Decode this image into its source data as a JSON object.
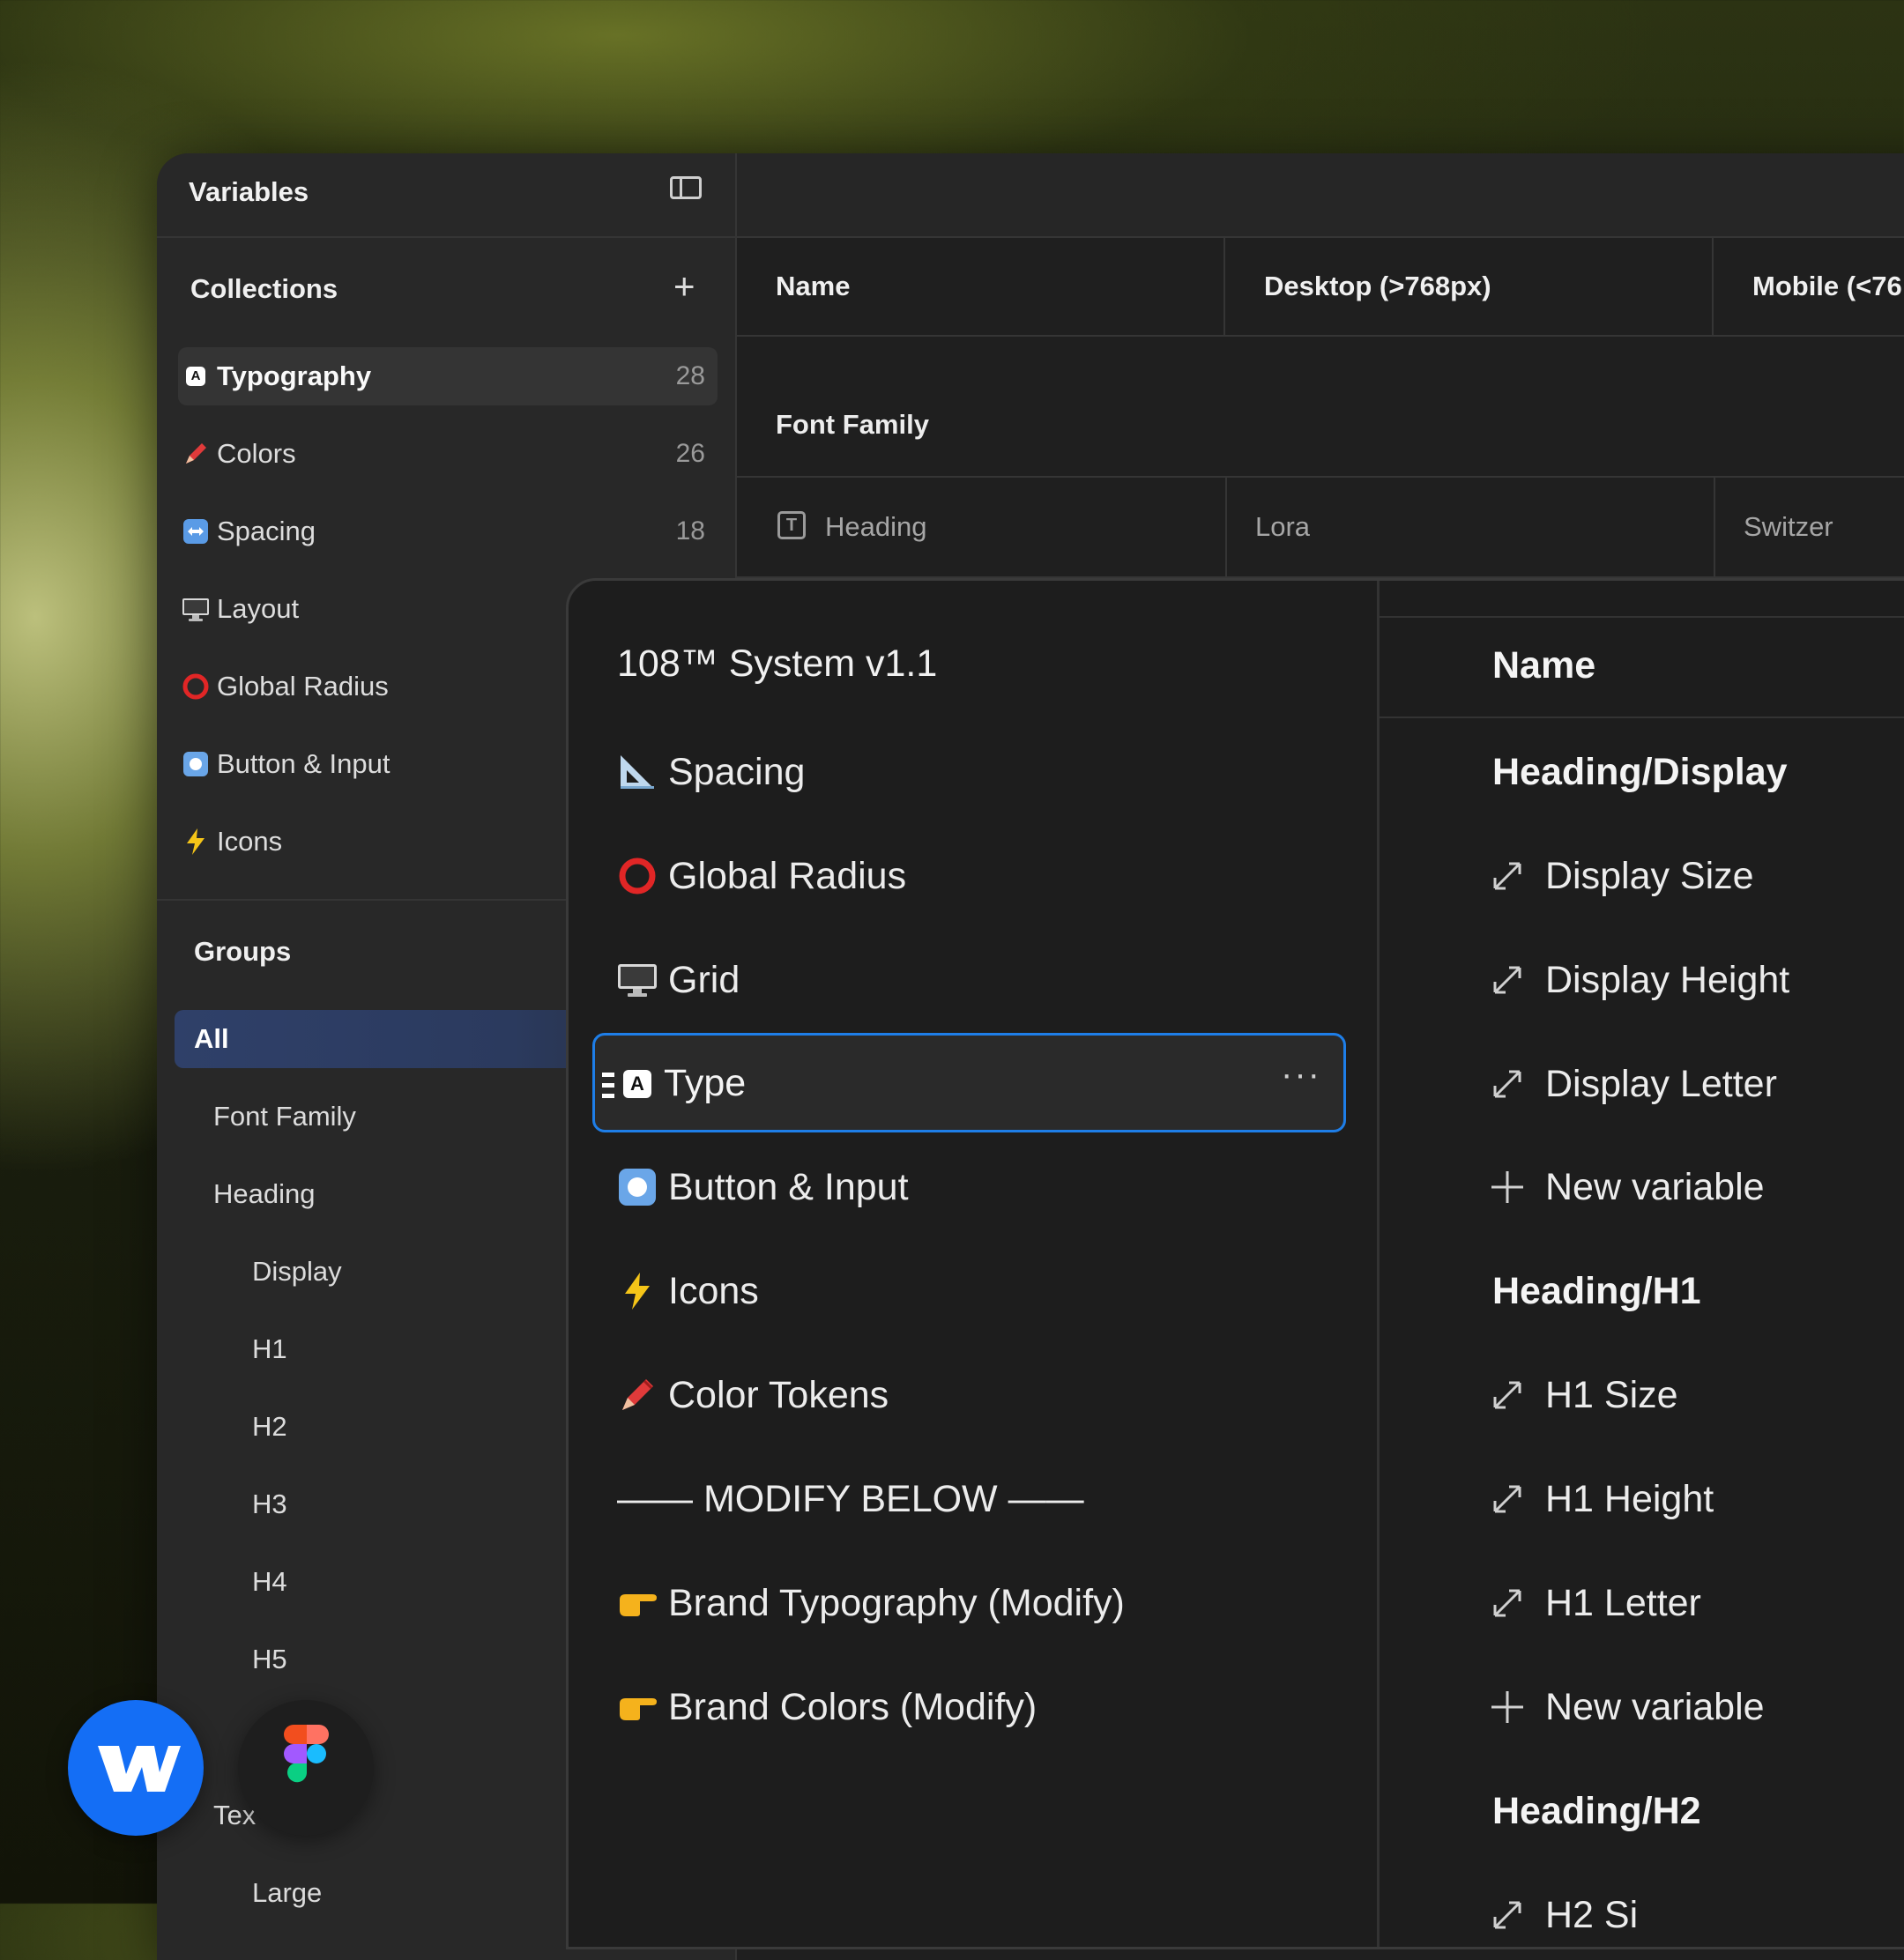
{
  "sidebar": {
    "title": "Variables",
    "collections_label": "Collections",
    "collections": [
      {
        "icon": "a-box-icon",
        "label": "Typography",
        "count": "28"
      },
      {
        "icon": "crayon-icon",
        "label": "Colors",
        "count": "26"
      },
      {
        "icon": "left-right-arrow-icon",
        "label": "Spacing",
        "count": "18"
      },
      {
        "icon": "desktop-computer-icon",
        "label": "Layout",
        "count": ""
      },
      {
        "icon": "red-circle-icon",
        "label": "Global Radius",
        "count": ""
      },
      {
        "icon": "record-button-icon",
        "label": "Button & Input",
        "count": ""
      },
      {
        "icon": "lightning-icon",
        "label": "Icons",
        "count": ""
      }
    ],
    "groups_label": "Groups",
    "groups": [
      {
        "label": "All",
        "level": 0,
        "active": true
      },
      {
        "label": "Font Family",
        "level": 1
      },
      {
        "label": "Heading",
        "level": 1
      },
      {
        "label": "Display",
        "level": 2
      },
      {
        "label": "H1",
        "level": 2
      },
      {
        "label": "H2",
        "level": 2
      },
      {
        "label": "H3",
        "level": 2
      },
      {
        "label": "H4",
        "level": 2
      },
      {
        "label": "H5",
        "level": 2
      },
      {
        "label": "Tex",
        "level": 1
      },
      {
        "label": "Large",
        "level": 2
      }
    ]
  },
  "table": {
    "columns": [
      "Name",
      "Desktop (>768px)",
      "Mobile (<76"
    ],
    "section": "Font Family",
    "row": {
      "name": "Heading",
      "desktop": "Lora",
      "mobile": "Switzer"
    }
  },
  "panel": {
    "title": "108™ System v1.1",
    "items": [
      {
        "icon": "triangular-ruler-icon",
        "label": "Spacing"
      },
      {
        "icon": "red-circle-icon",
        "label": "Global Radius"
      },
      {
        "icon": "desktop-computer-icon",
        "label": "Grid"
      },
      {
        "icon": "a-box-icon",
        "label": "Type",
        "selected": true
      },
      {
        "icon": "record-button-icon",
        "label": "Button & Input"
      },
      {
        "icon": "lightning-icon",
        "label": "Icons"
      },
      {
        "icon": "crayon-icon",
        "label": "Color Tokens"
      },
      {
        "icon": "",
        "label": "—— MODIFY BELOW ——"
      },
      {
        "icon": "pointing-hand-icon",
        "label": "Brand Typography (Modify)"
      },
      {
        "icon": "pointing-hand-icon",
        "label": "Brand Colors (Modify)"
      }
    ],
    "more_label": "···",
    "right_header": "Name",
    "right_items": [
      {
        "type": "heading",
        "label": "Heading/Display"
      },
      {
        "type": "var",
        "icon": "resize-arrow-icon",
        "label": "Display Size"
      },
      {
        "type": "var",
        "icon": "resize-arrow-icon",
        "label": "Display Height"
      },
      {
        "type": "var",
        "icon": "resize-arrow-icon",
        "label": "Display Letter"
      },
      {
        "type": "new",
        "icon": "plus-icon",
        "label": "New variable"
      },
      {
        "type": "heading",
        "label": "Heading/H1"
      },
      {
        "type": "var",
        "icon": "resize-arrow-icon",
        "label": "H1 Size"
      },
      {
        "type": "var",
        "icon": "resize-arrow-icon",
        "label": "H1 Height"
      },
      {
        "type": "var",
        "icon": "resize-arrow-icon",
        "label": "H1 Letter"
      },
      {
        "type": "new",
        "icon": "plus-icon",
        "label": "New variable"
      },
      {
        "type": "heading",
        "label": "Heading/H2"
      },
      {
        "type": "var",
        "icon": "resize-arrow-icon",
        "label": "H2 Si"
      }
    ]
  },
  "badges": [
    {
      "name": "webflow-logo",
      "color": "#146ef5"
    },
    {
      "name": "figma-logo",
      "color": "#1e1e1e"
    }
  ]
}
